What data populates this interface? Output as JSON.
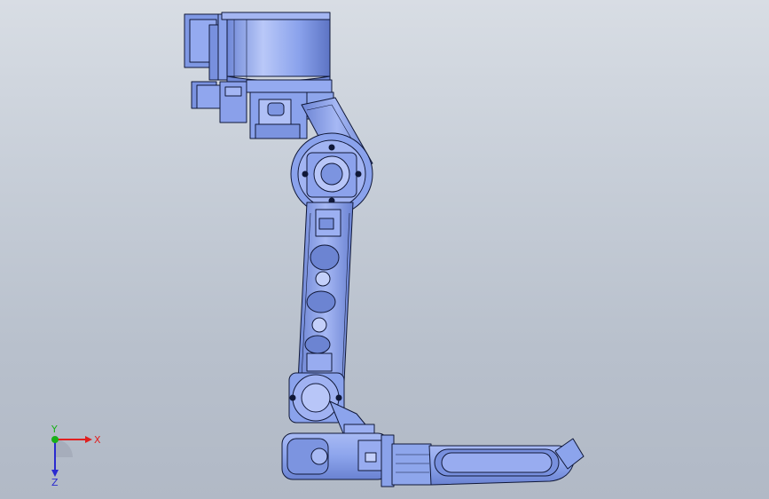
{
  "triad": {
    "x_label": "X",
    "y_label": "Y",
    "z_label": "Z",
    "x_color": "#e02020",
    "y_color": "#18b018",
    "z_color": "#2a2ad0"
  },
  "model": {
    "fill": "#8ea6ee",
    "fill_light": "#b6c6f6",
    "fill_dark": "#5c74c6",
    "edge": "#101838"
  }
}
